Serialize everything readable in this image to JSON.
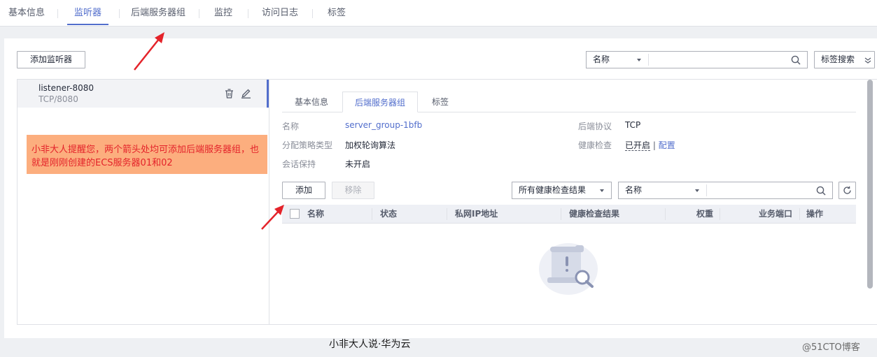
{
  "top_tabs": [
    {
      "label": "基本信息"
    },
    {
      "label": "监听器"
    },
    {
      "label": "后端服务器组"
    },
    {
      "label": "监控"
    },
    {
      "label": "访问日志"
    },
    {
      "label": "标签"
    }
  ],
  "toolbar": {
    "add_listener_label": "添加监听器",
    "search_field_select": "名称",
    "search_input_value": "",
    "tag_search_label": "标签搜索"
  },
  "listener": {
    "name": "listener-8080",
    "protocol_port": "TCP/8080"
  },
  "note": {
    "text": "小非大人提醒您，两个箭头处均可添加后端服务器组，也就是刚刚创建的ECS服务器01和02"
  },
  "sub_tabs": [
    {
      "label": "基本信息"
    },
    {
      "label": "后端服务器组"
    },
    {
      "label": "标签"
    }
  ],
  "group": {
    "name_label": "名称",
    "name_value": "server_group-1bfb",
    "algorithm_label": "分配策略类型",
    "algorithm_value": "加权轮询算法",
    "session_label": "会话保持",
    "session_value": "未开启",
    "protocol_label": "后端协议",
    "protocol_value": "TCP",
    "health_label": "健康检查",
    "health_value": "已开启",
    "health_separator": "|",
    "health_config": "配置"
  },
  "member_toolbar": {
    "add_label": "添加",
    "remove_label": "移除",
    "health_filter": "所有健康检查结果",
    "search_field_select": "名称",
    "search_input_value": ""
  },
  "table": {
    "columns": [
      "名称",
      "状态",
      "私网IP地址",
      "健康检查结果",
      "权重",
      "业务端口",
      "操作"
    ],
    "rows": []
  },
  "footer": {
    "caption": "小非大人说·华为云",
    "watermark": "@51CTO博客"
  }
}
